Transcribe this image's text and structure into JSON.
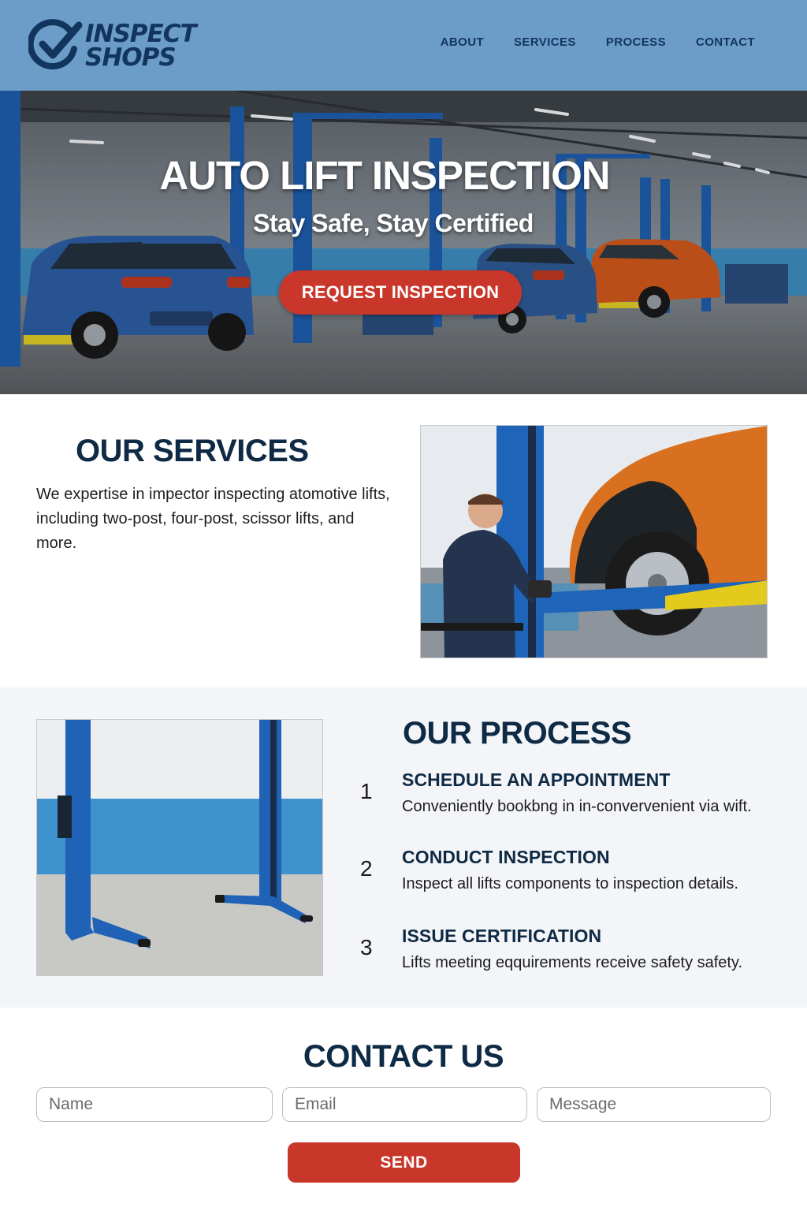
{
  "brand": {
    "name_line1": "INSPECT",
    "name_line2": "SHOPS",
    "logo_icon": "checkmark-circle-icon",
    "color_dark_blue": "#12355e",
    "color_header": "#6b9dc8",
    "color_accent_red": "#c9362a"
  },
  "nav": {
    "items": [
      "ABOUT",
      "SERVICES",
      "PROCESS",
      "CONTACT"
    ]
  },
  "hero": {
    "title": "AUTO LIFT INSPECTION",
    "subtitle": "Stay Safe, Stay Certified",
    "button_label": "REQUEST INSPECTION"
  },
  "services": {
    "title": "OUR SERVICES",
    "description": "We expertise in impector inspecting atomotive lifts, including two-post, four-post, scissor lifts, and more."
  },
  "process": {
    "title": "OUR PROCESS",
    "steps": [
      {
        "number": "1",
        "title": "SCHEDULE AN APPOINTMENT",
        "description": "Conveniently bookbng in in-convervenient via wift."
      },
      {
        "number": "2",
        "title": "CONDUCT INSPECTION",
        "description": "Inspect all lifts components to inspection details."
      },
      {
        "number": "3",
        "title": "ISSUE CERTIFICATION",
        "description": "Lifts meeting eqquirements receive safety safety."
      }
    ]
  },
  "contact": {
    "title": "CONTACT US",
    "name_placeholder": "Name",
    "email_placeholder": "Email",
    "message_placeholder": "Message",
    "send_label": "SEND"
  }
}
